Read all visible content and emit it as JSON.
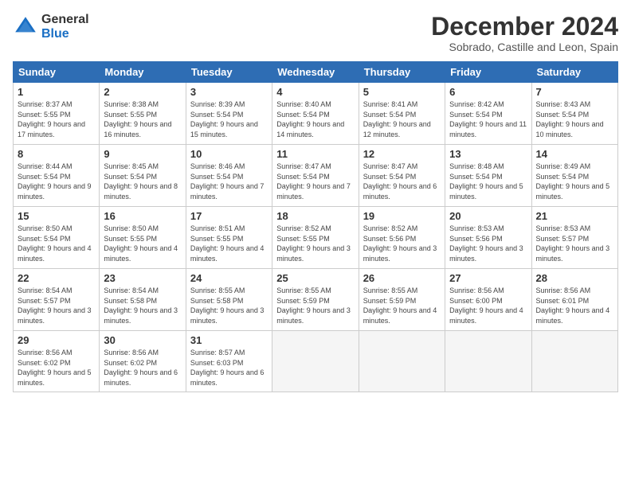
{
  "logo": {
    "general": "General",
    "blue": "Blue"
  },
  "title": "December 2024",
  "subtitle": "Sobrado, Castille and Leon, Spain",
  "headers": [
    "Sunday",
    "Monday",
    "Tuesday",
    "Wednesday",
    "Thursday",
    "Friday",
    "Saturday"
  ],
  "weeks": [
    [
      {
        "day": "1",
        "sunrise": "8:37 AM",
        "sunset": "5:55 PM",
        "daylight": "9 hours and 17 minutes."
      },
      {
        "day": "2",
        "sunrise": "8:38 AM",
        "sunset": "5:55 PM",
        "daylight": "9 hours and 16 minutes."
      },
      {
        "day": "3",
        "sunrise": "8:39 AM",
        "sunset": "5:54 PM",
        "daylight": "9 hours and 15 minutes."
      },
      {
        "day": "4",
        "sunrise": "8:40 AM",
        "sunset": "5:54 PM",
        "daylight": "9 hours and 14 minutes."
      },
      {
        "day": "5",
        "sunrise": "8:41 AM",
        "sunset": "5:54 PM",
        "daylight": "9 hours and 12 minutes."
      },
      {
        "day": "6",
        "sunrise": "8:42 AM",
        "sunset": "5:54 PM",
        "daylight": "9 hours and 11 minutes."
      },
      {
        "day": "7",
        "sunrise": "8:43 AM",
        "sunset": "5:54 PM",
        "daylight": "9 hours and 10 minutes."
      }
    ],
    [
      {
        "day": "8",
        "sunrise": "8:44 AM",
        "sunset": "5:54 PM",
        "daylight": "9 hours and 9 minutes."
      },
      {
        "day": "9",
        "sunrise": "8:45 AM",
        "sunset": "5:54 PM",
        "daylight": "9 hours and 8 minutes."
      },
      {
        "day": "10",
        "sunrise": "8:46 AM",
        "sunset": "5:54 PM",
        "daylight": "9 hours and 7 minutes."
      },
      {
        "day": "11",
        "sunrise": "8:47 AM",
        "sunset": "5:54 PM",
        "daylight": "9 hours and 7 minutes."
      },
      {
        "day": "12",
        "sunrise": "8:47 AM",
        "sunset": "5:54 PM",
        "daylight": "9 hours and 6 minutes."
      },
      {
        "day": "13",
        "sunrise": "8:48 AM",
        "sunset": "5:54 PM",
        "daylight": "9 hours and 5 minutes."
      },
      {
        "day": "14",
        "sunrise": "8:49 AM",
        "sunset": "5:54 PM",
        "daylight": "9 hours and 5 minutes."
      }
    ],
    [
      {
        "day": "15",
        "sunrise": "8:50 AM",
        "sunset": "5:54 PM",
        "daylight": "9 hours and 4 minutes."
      },
      {
        "day": "16",
        "sunrise": "8:50 AM",
        "sunset": "5:55 PM",
        "daylight": "9 hours and 4 minutes."
      },
      {
        "day": "17",
        "sunrise": "8:51 AM",
        "sunset": "5:55 PM",
        "daylight": "9 hours and 4 minutes."
      },
      {
        "day": "18",
        "sunrise": "8:52 AM",
        "sunset": "5:55 PM",
        "daylight": "9 hours and 3 minutes."
      },
      {
        "day": "19",
        "sunrise": "8:52 AM",
        "sunset": "5:56 PM",
        "daylight": "9 hours and 3 minutes."
      },
      {
        "day": "20",
        "sunrise": "8:53 AM",
        "sunset": "5:56 PM",
        "daylight": "9 hours and 3 minutes."
      },
      {
        "day": "21",
        "sunrise": "8:53 AM",
        "sunset": "5:57 PM",
        "daylight": "9 hours and 3 minutes."
      }
    ],
    [
      {
        "day": "22",
        "sunrise": "8:54 AM",
        "sunset": "5:57 PM",
        "daylight": "9 hours and 3 minutes."
      },
      {
        "day": "23",
        "sunrise": "8:54 AM",
        "sunset": "5:58 PM",
        "daylight": "9 hours and 3 minutes."
      },
      {
        "day": "24",
        "sunrise": "8:55 AM",
        "sunset": "5:58 PM",
        "daylight": "9 hours and 3 minutes."
      },
      {
        "day": "25",
        "sunrise": "8:55 AM",
        "sunset": "5:59 PM",
        "daylight": "9 hours and 3 minutes."
      },
      {
        "day": "26",
        "sunrise": "8:55 AM",
        "sunset": "5:59 PM",
        "daylight": "9 hours and 4 minutes."
      },
      {
        "day": "27",
        "sunrise": "8:56 AM",
        "sunset": "6:00 PM",
        "daylight": "9 hours and 4 minutes."
      },
      {
        "day": "28",
        "sunrise": "8:56 AM",
        "sunset": "6:01 PM",
        "daylight": "9 hours and 4 minutes."
      }
    ],
    [
      {
        "day": "29",
        "sunrise": "8:56 AM",
        "sunset": "6:02 PM",
        "daylight": "9 hours and 5 minutes."
      },
      {
        "day": "30",
        "sunrise": "8:56 AM",
        "sunset": "6:02 PM",
        "daylight": "9 hours and 6 minutes."
      },
      {
        "day": "31",
        "sunrise": "8:57 AM",
        "sunset": "6:03 PM",
        "daylight": "9 hours and 6 minutes."
      },
      null,
      null,
      null,
      null
    ]
  ]
}
